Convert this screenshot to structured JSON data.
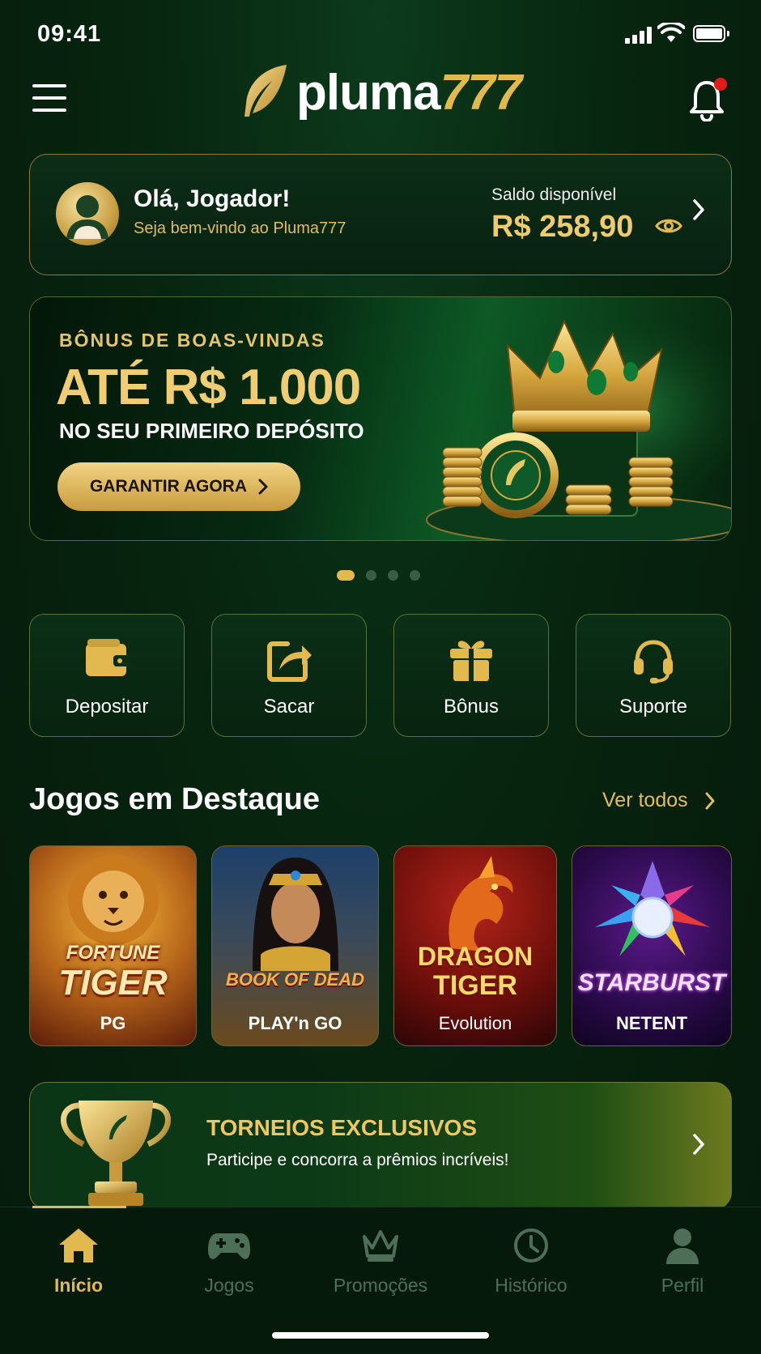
{
  "status_bar": {
    "time": "09:41"
  },
  "header": {
    "logo_plain": "pluma",
    "logo_accent": "777"
  },
  "user_card": {
    "greeting": "Olá, Jogador!",
    "welcome": "Seja bem-vindo ao Pluma777",
    "balance_label": "Saldo disponível",
    "balance_value": "R$ 258,90"
  },
  "banner": {
    "subtitle": "BÔNUS DE BOAS-VINDAS",
    "title": "ATÉ R$ 1.000",
    "description": "NO SEU PRIMEIRO DEPÓSITO",
    "cta": "GARANTIR AGORA",
    "pages": 4,
    "active_page": 1
  },
  "quick_actions": [
    {
      "label": "Depositar",
      "icon": "wallet-icon"
    },
    {
      "label": "Sacar",
      "icon": "withdraw-icon"
    },
    {
      "label": "Bônus",
      "icon": "gift-icon"
    },
    {
      "label": "Suporte",
      "icon": "headset-icon"
    }
  ],
  "featured": {
    "title": "Jogos em Destaque",
    "see_all": "Ver todos",
    "games": [
      {
        "name_line1": "FORTUNE",
        "name_line2": "TIGER",
        "provider": "PG"
      },
      {
        "name_line1": "BOOK OF DEAD",
        "name_line2": "",
        "provider": "PLAY'n GO"
      },
      {
        "name_line1": "DRAGON",
        "name_line2": "TIGER",
        "provider": "Evolution"
      },
      {
        "name_line1": "STARBURST",
        "name_line2": "",
        "provider": "NETENT"
      }
    ]
  },
  "tournament": {
    "title": "TORNEIOS EXCLUSIVOS",
    "description": "Participe e concorra a prêmios incríveis!"
  },
  "bottom_nav": [
    {
      "label": "Início",
      "icon": "home-icon",
      "active": true
    },
    {
      "label": "Jogos",
      "icon": "gamepad-icon",
      "active": false
    },
    {
      "label": "Promoções",
      "icon": "crown-icon",
      "active": false
    },
    {
      "label": "Histórico",
      "icon": "clock-icon",
      "active": false
    },
    {
      "label": "Perfil",
      "icon": "user-icon",
      "active": false
    }
  ],
  "colors": {
    "accent_gold": "#e2b94f",
    "background": "#07200f",
    "notification": "#e31a1a"
  }
}
